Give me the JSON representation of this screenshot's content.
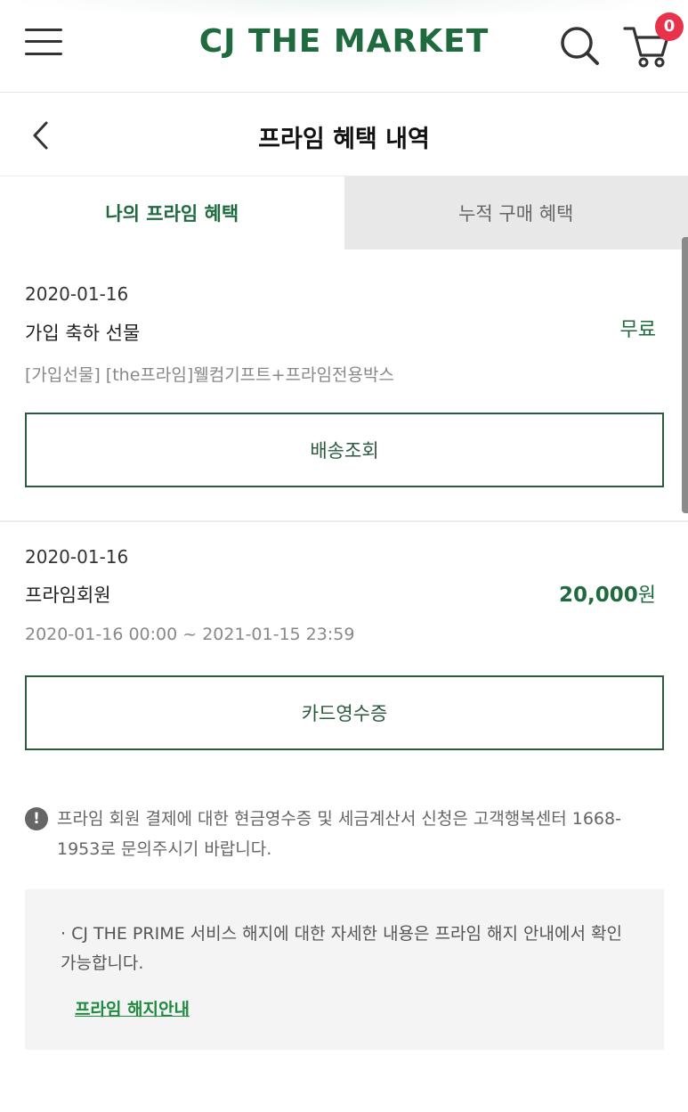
{
  "header": {
    "logo": "CJ THE MARKET",
    "cart_count": "0"
  },
  "titlebar": {
    "title": "프라임 혜택 내역"
  },
  "tabs": [
    {
      "label": "나의 프라임 혜택",
      "active": true
    },
    {
      "label": "누적 구매 혜택",
      "active": false
    }
  ],
  "cards": [
    {
      "date": "2020-01-16",
      "name": "가입 축하 선물",
      "price": "무료",
      "desc": "[가입선물] [the프라임]웰컴기프트+프라임전용박스",
      "button": "배송조회"
    },
    {
      "date": "2020-01-16",
      "name": "프라임회원",
      "price_num": "20,000",
      "price_unit": "원",
      "desc": "2020-01-16 00:00 ~ 2021-01-15 23:59",
      "button": "카드영수증"
    }
  ],
  "notice": {
    "icon_text": "!",
    "text": "프라임 회원 결제에 대한 현금영수증 및 세금계산서 신청은 고객행복센터 1668-1953로 문의주시기 바랍니다."
  },
  "info": {
    "text": "· CJ THE PRIME 서비스 해지에 대한 자세한 내용은 프라임 해지 안내에서 확인가능합니다.",
    "link": "프라임 해지안내"
  },
  "colors": {
    "brand_green": "#1f6b3f",
    "badge_red": "#e8334a",
    "link_green": "#1f8a3f"
  }
}
